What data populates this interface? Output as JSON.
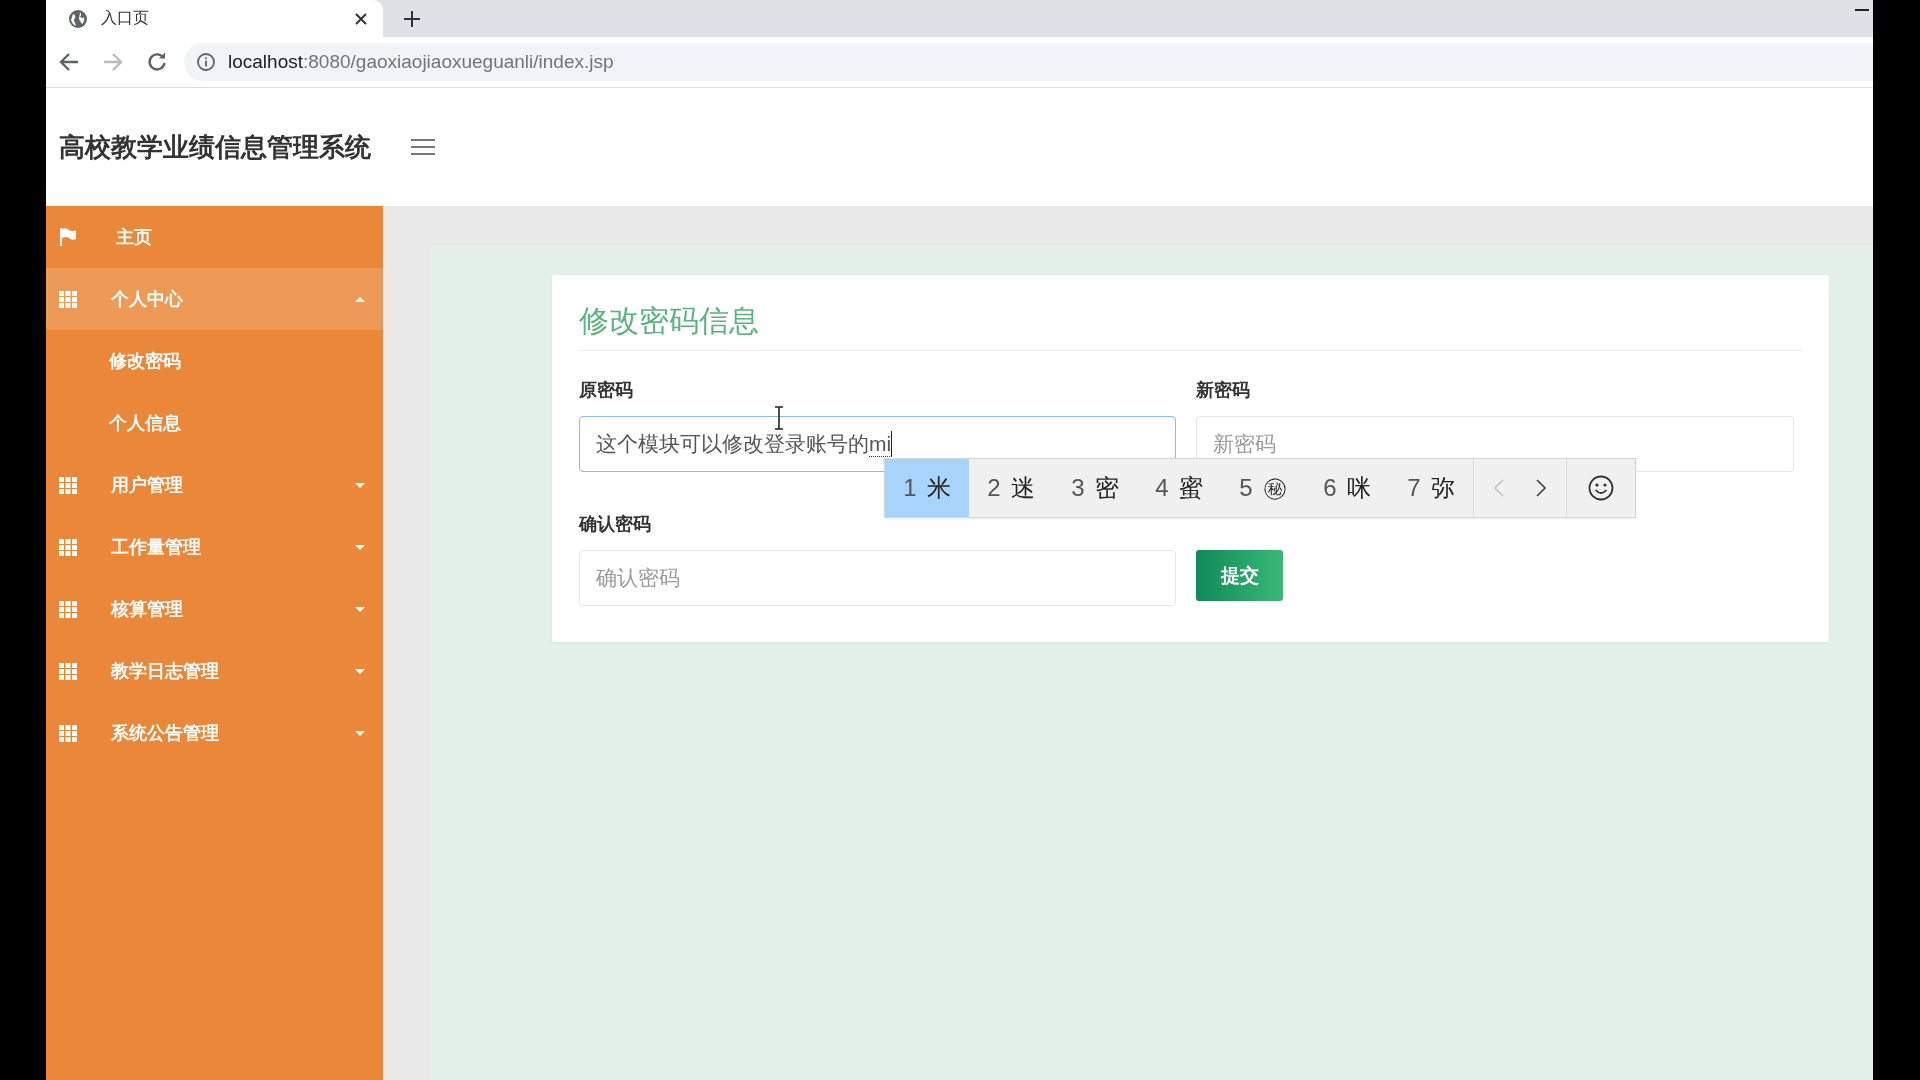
{
  "browser": {
    "tab": {
      "title": "入口页",
      "selected": true
    },
    "toolbar": {
      "back": {
        "disabled": false
      },
      "forward": {
        "disabled": true
      },
      "url": {
        "host": "localhost",
        "path": ":8080/gaoxiaojiaoxueguanli/index.jsp"
      }
    }
  },
  "header": {
    "title": "高校教学业绩信息管理系统"
  },
  "sidebar": {
    "items": [
      {
        "kind": "link",
        "label": "主页"
      },
      {
        "kind": "group",
        "label": "个人中心",
        "expanded": true,
        "children": [
          {
            "label": "修改密码"
          },
          {
            "label": "个人信息"
          }
        ]
      },
      {
        "kind": "group",
        "label": "用户管理",
        "expanded": false
      },
      {
        "kind": "group",
        "label": "工作量管理",
        "expanded": false
      },
      {
        "kind": "group",
        "label": "核算管理",
        "expanded": false
      },
      {
        "kind": "group",
        "label": "教学日志管理",
        "expanded": false
      },
      {
        "kind": "group",
        "label": "系统公告管理",
        "expanded": false
      }
    ]
  },
  "form": {
    "title": "修改密码信息",
    "fields": [
      {
        "label": "原密码",
        "value": "这个模块可以修改登录账号的",
        "composition": "mi",
        "focused": true
      },
      {
        "label": "新密码",
        "placeholder": "新密码",
        "focused": false
      },
      {
        "label": "确认密码",
        "placeholder": "确认密码",
        "focused": false
      }
    ],
    "submit": "提交"
  },
  "ime": {
    "candidates": [
      {
        "number": "1",
        "text": "米",
        "selected": true
      },
      {
        "number": "2",
        "text": "迷",
        "selected": false
      },
      {
        "number": "3",
        "text": "密",
        "selected": false
      },
      {
        "number": "4",
        "text": "蜜",
        "selected": false
      },
      {
        "number": "5",
        "text": "㊙",
        "selected": false
      },
      {
        "number": "6",
        "text": "咪",
        "selected": false
      },
      {
        "number": "7",
        "text": "弥",
        "selected": false
      }
    ],
    "prev": {
      "disabled": true
    },
    "next": {
      "disabled": false
    }
  }
}
